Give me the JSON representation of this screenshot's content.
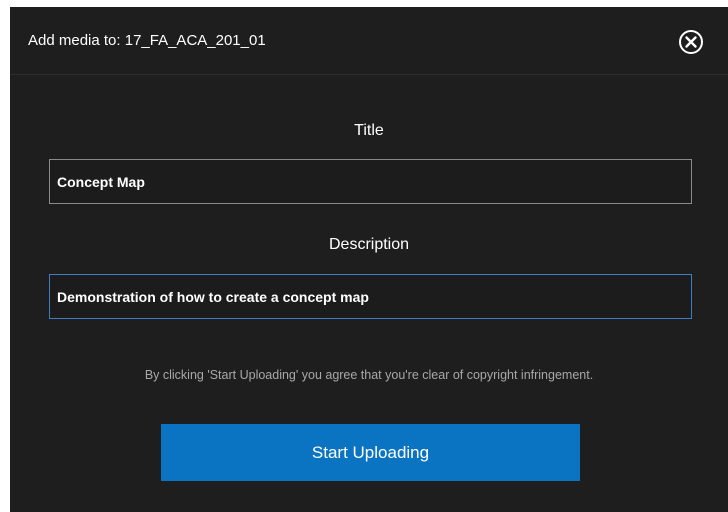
{
  "dialog": {
    "title": "Add media to: 17_FA_ACA_201_01",
    "close_icon": "close-circle-icon"
  },
  "form": {
    "title_label": "Title",
    "title_value": "Concept Map",
    "description_label": "Description",
    "description_value": "Demonstration of how to create a concept map"
  },
  "notice": "By clicking 'Start Uploading' you agree that you're clear of copyright infringement.",
  "actions": {
    "start_uploading_label": "Start Uploading"
  },
  "colors": {
    "dialog_background": "#1e1e1e",
    "primary_button": "#0a74c2",
    "focus_border": "#3d7ec4"
  }
}
